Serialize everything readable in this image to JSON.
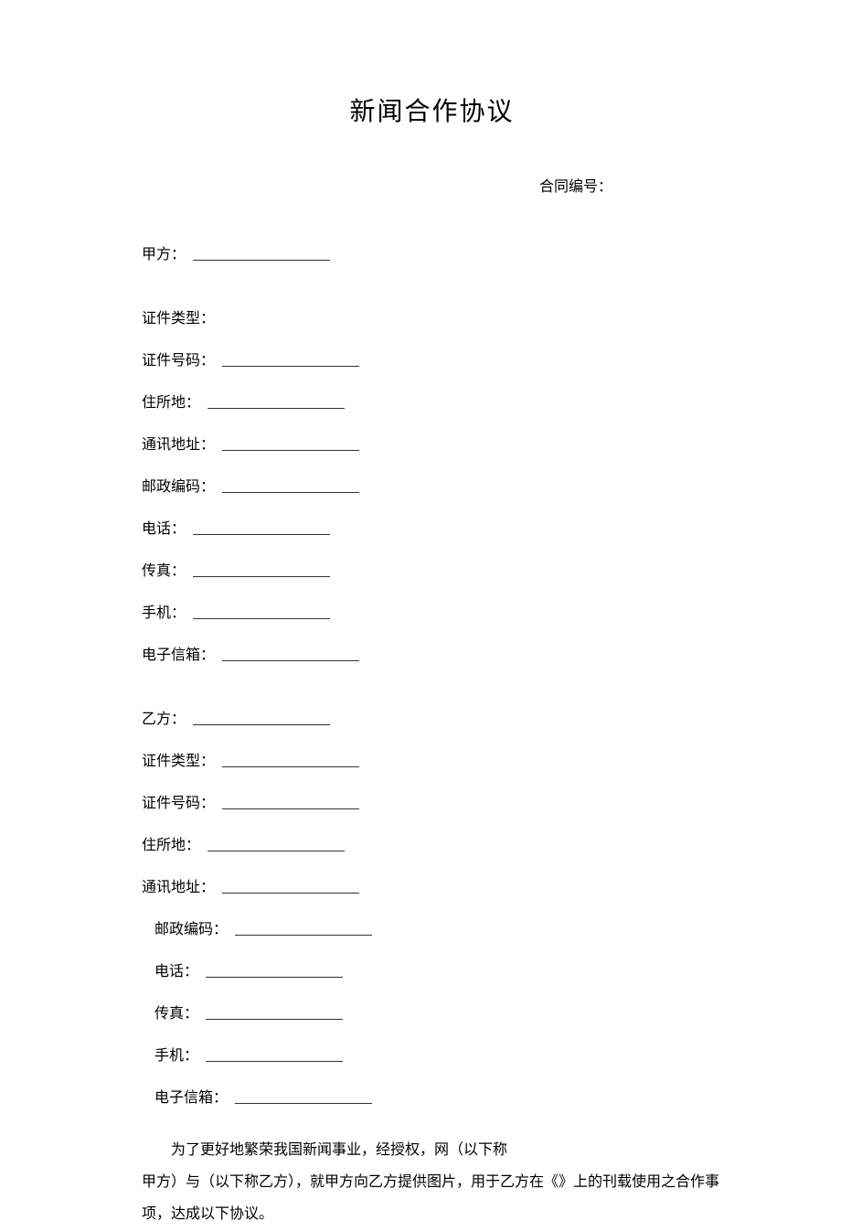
{
  "title": "新闻合作协议",
  "contract_no_label": "合同编号：",
  "party_a": {
    "name_label": "甲方：",
    "cert_type_label": "证件类型：",
    "cert_no_label": "证件号码：",
    "address_label": "住所地：",
    "mailing_label": "通讯地址：",
    "postal_label": "邮政编码：",
    "phone_label": "电话：",
    "fax_label": "传真：",
    "mobile_label": "手机：",
    "email_label": "电子信箱："
  },
  "party_b": {
    "name_label": "乙方：",
    "cert_type_label": "证件类型：",
    "cert_no_label": "证件号码：",
    "address_label": "住所地：",
    "mailing_label": "通讯地址：",
    "postal_label": "邮政编码：",
    "phone_label": "电话：",
    "fax_label": "传真：",
    "mobile_label": "手机：",
    "email_label": "电子信箱："
  },
  "paragraph": {
    "line1": "为了更好地繁荣我国新闻事业，经授权，网（以下称",
    "line2": "甲方）与（以下称乙方），就甲方向乙方提供图片，用于乙方在《》上的刊载使用之合作事项，达成以下协议。"
  }
}
